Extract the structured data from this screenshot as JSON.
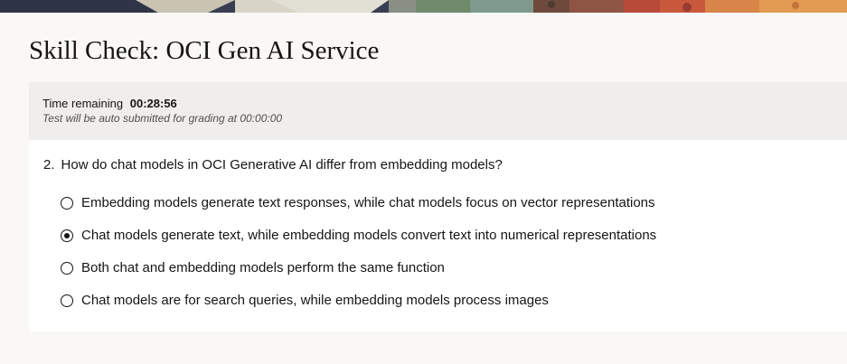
{
  "header": {
    "title": "Skill Check: OCI Gen AI Service"
  },
  "timer": {
    "label": "Time remaining",
    "value": "00:28:56",
    "note": "Test will be auto submitted for grading at 00:00:00"
  },
  "question": {
    "number": "2.",
    "text": "How do chat models in OCI Generative AI differ from embedding models?",
    "selected_index": 1,
    "options": [
      {
        "label": "Embedding models generate text responses, while chat models focus on vector representations",
        "selected": false
      },
      {
        "label": "Chat models generate text, while embedding models convert text into numerical representations",
        "selected": true
      },
      {
        "label": "Both chat and embedding models perform the same function",
        "selected": false
      },
      {
        "label": "Chat models are for search queries, while embedding models process images",
        "selected": false
      }
    ]
  },
  "colors": {
    "page_background": "#f9f8f6",
    "timer_panel": "#efeeec",
    "card": "#ffffff",
    "text": "#161513"
  }
}
